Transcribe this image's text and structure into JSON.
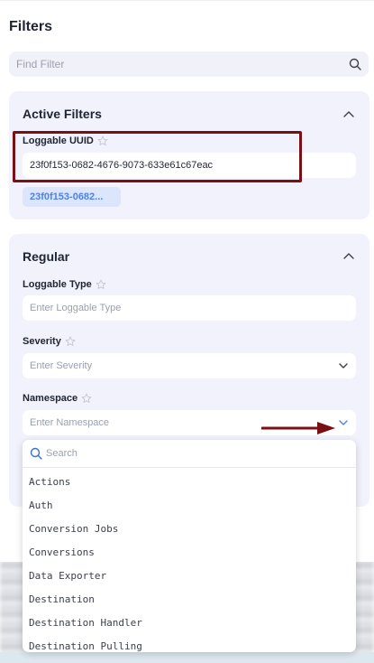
{
  "filters": {
    "title": "Filters",
    "find_placeholder": "Find Filter"
  },
  "active_filters": {
    "title": "Active Filters",
    "loggable_uuid": {
      "label": "Loggable UUID",
      "value": "23f0f153-0682-4676-9073-633e61c67eac",
      "chip": "23f0f153-0682..."
    }
  },
  "regular": {
    "title": "Regular",
    "loggable_type": {
      "label": "Loggable Type",
      "placeholder": "Enter Loggable Type"
    },
    "severity": {
      "label": "Severity",
      "placeholder": "Enter Severity"
    },
    "namespace": {
      "label": "Namespace",
      "placeholder": "Enter Namespace"
    }
  },
  "dropdown": {
    "search_placeholder": "Search",
    "options": [
      "Actions",
      "Auth",
      "Conversion Jobs",
      "Conversions",
      "Data Exporter",
      "Destination",
      "Destination Handler",
      "Destination Pulling"
    ]
  },
  "colors": {
    "card_bg": "#f1f2fb",
    "chip_bg": "#dbe5fb",
    "chip_text": "#4f82e6",
    "highlight": "#7a0f14"
  }
}
